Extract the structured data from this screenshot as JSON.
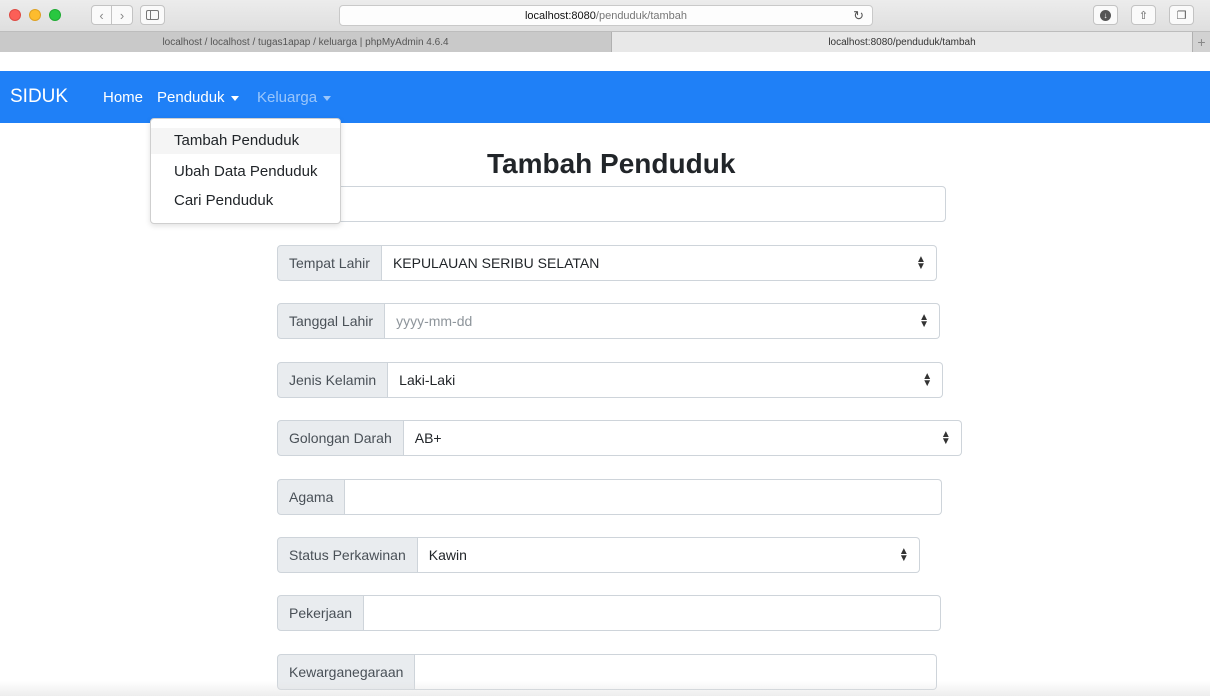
{
  "browser": {
    "address_host": "localhost:8080",
    "address_path": "/penduduk/tambah",
    "tabs": [
      {
        "label": "localhost / localhost / tugas1apap / keluarga | phpMyAdmin 4.6.4"
      },
      {
        "label": "localhost:8080/penduduk/tambah"
      }
    ],
    "icons": [
      "back-icon",
      "forward-icon",
      "sidebar-icon",
      "reload-icon",
      "download-icon",
      "share-icon",
      "tabs-icon",
      "new-tab-icon"
    ]
  },
  "navbar": {
    "brand": "SIDUK",
    "home": "Home",
    "penduduk": "Penduduk",
    "keluarga": "Keluarga",
    "color": "#1f80f7"
  },
  "dropdown": {
    "items": [
      "Tambah Penduduk",
      "Ubah Data Penduduk",
      "Cari Penduduk"
    ]
  },
  "page": {
    "title": "Tambah Penduduk"
  },
  "form": {
    "fields": [
      {
        "label": "Tempat Lahir",
        "value": "KEPULAUAN SERIBU SELATAN",
        "type": "select"
      },
      {
        "label": "Tanggal Lahir",
        "placeholder": "yyyy-mm-dd",
        "type": "date"
      },
      {
        "label": "Jenis Kelamin",
        "value": "Laki-Laki",
        "type": "select"
      },
      {
        "label": "Golongan Darah",
        "value": "AB+",
        "type": "select"
      },
      {
        "label": "Agama",
        "value": "",
        "type": "text"
      },
      {
        "label": "Status Perkawinan",
        "value": "Kawin",
        "type": "select"
      },
      {
        "label": "Pekerjaan",
        "value": "",
        "type": "text"
      },
      {
        "label": "Kewarganegaraan",
        "value": "",
        "type": "text"
      }
    ]
  }
}
